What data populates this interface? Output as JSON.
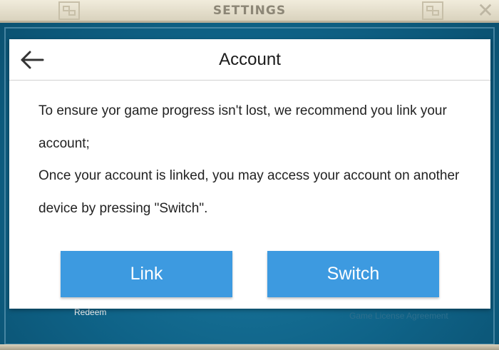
{
  "background": {
    "title": "SETTINGS",
    "close_glyph": "✕",
    "redeem_label": "Redeem",
    "license_label": "Game License Agreement"
  },
  "dialog": {
    "title": "Account",
    "back_icon": "arrow-left-icon",
    "paragraph_1": "To ensure yor game progress isn't lost, we recommend you link your account;",
    "paragraph_2": "Once your account is linked, you may access your account on another device by pressing \"Switch\".",
    "link_label": "Link",
    "switch_label": "Switch"
  },
  "colors": {
    "button": "#3d9ae0",
    "background_teal": "#0f6388",
    "header_bar": "#e8e2cf"
  }
}
